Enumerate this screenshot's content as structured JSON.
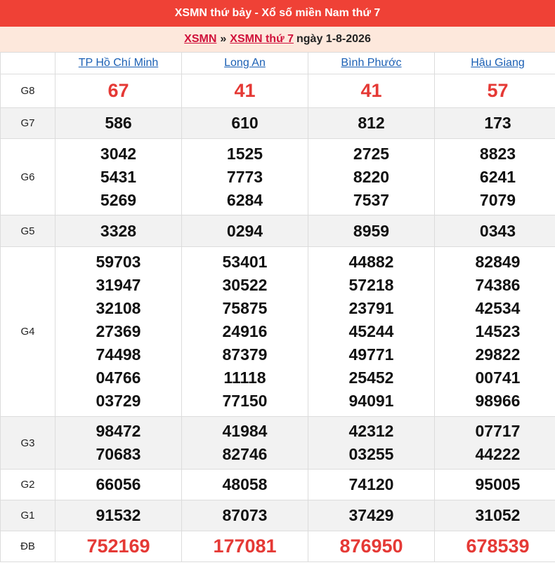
{
  "header": {
    "title": "XSMN thứ bảy - Xổ số miền Nam thứ 7",
    "breadcrumb": {
      "link1": "XSMN",
      "separator": "»",
      "link2": "XSMN thứ 7",
      "date": "ngày 1-8-2026"
    }
  },
  "colors": {
    "title_bg": "#ef4136",
    "subtitle_bg": "#fde8dc",
    "highlight_number": "#e53935",
    "link_blue": "#1a5fb4",
    "link_red": "#d0103a"
  },
  "provinces": [
    "TP Hồ Chí Minh",
    "Long An",
    "Bình Phước",
    "Hậu Giang"
  ],
  "prizes": [
    {
      "label": "G8",
      "results": [
        [
          "67"
        ],
        [
          "41"
        ],
        [
          "41"
        ],
        [
          "57"
        ]
      ]
    },
    {
      "label": "G7",
      "results": [
        [
          "586"
        ],
        [
          "610"
        ],
        [
          "812"
        ],
        [
          "173"
        ]
      ]
    },
    {
      "label": "G6",
      "results": [
        [
          "3042",
          "5431",
          "5269"
        ],
        [
          "1525",
          "7773",
          "6284"
        ],
        [
          "2725",
          "8220",
          "7537"
        ],
        [
          "8823",
          "6241",
          "7079"
        ]
      ]
    },
    {
      "label": "G5",
      "results": [
        [
          "3328"
        ],
        [
          "0294"
        ],
        [
          "8959"
        ],
        [
          "0343"
        ]
      ]
    },
    {
      "label": "G4",
      "results": [
        [
          "59703",
          "31947",
          "32108",
          "27369",
          "74498",
          "04766",
          "03729"
        ],
        [
          "53401",
          "30522",
          "75875",
          "24916",
          "87379",
          "11118",
          "77150"
        ],
        [
          "44882",
          "57218",
          "23791",
          "45244",
          "49771",
          "25452",
          "94091"
        ],
        [
          "82849",
          "74386",
          "42534",
          "14523",
          "29822",
          "00741",
          "98966"
        ]
      ]
    },
    {
      "label": "G3",
      "results": [
        [
          "98472",
          "70683"
        ],
        [
          "41984",
          "82746"
        ],
        [
          "42312",
          "03255"
        ],
        [
          "07717",
          "44222"
        ]
      ]
    },
    {
      "label": "G2",
      "results": [
        [
          "66056"
        ],
        [
          "48058"
        ],
        [
          "74120"
        ],
        [
          "95005"
        ]
      ]
    },
    {
      "label": "G1",
      "results": [
        [
          "91532"
        ],
        [
          "87073"
        ],
        [
          "37429"
        ],
        [
          "31052"
        ]
      ]
    },
    {
      "label": "ĐB",
      "results": [
        [
          "752169"
        ],
        [
          "177081"
        ],
        [
          "876950"
        ],
        [
          "678539"
        ]
      ]
    }
  ]
}
